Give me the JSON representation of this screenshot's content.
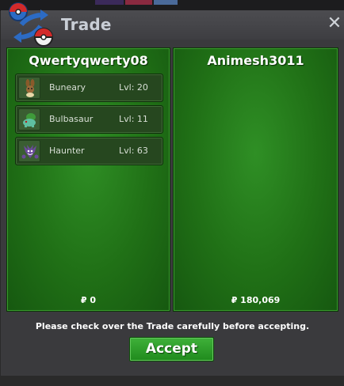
{
  "window": {
    "title": "Trade",
    "close_label": "✕"
  },
  "left_trader": {
    "name": "Qwertyqwerty08",
    "pokemon": [
      {
        "name": "Buneary",
        "level": "Lvl: 20",
        "icon": "buneary-icon"
      },
      {
        "name": "Bulbasaur",
        "level": "Lvl: 11",
        "icon": "bulbasaur-icon"
      },
      {
        "name": "Haunter",
        "level": "Lvl: 63",
        "icon": "haunter-icon"
      }
    ],
    "money": "₽ 0"
  },
  "right_trader": {
    "name": "Animesh3011",
    "pokemon": [],
    "money": "₽ 180,069"
  },
  "notice": "Please check over the Trade carefully before accepting.",
  "accept_label": "Accept",
  "colors": {
    "panel_green": "#207016",
    "accept_green": "#2f9e2a",
    "window_bg": "#3a3a3d",
    "title_text": "#c9ced6"
  }
}
